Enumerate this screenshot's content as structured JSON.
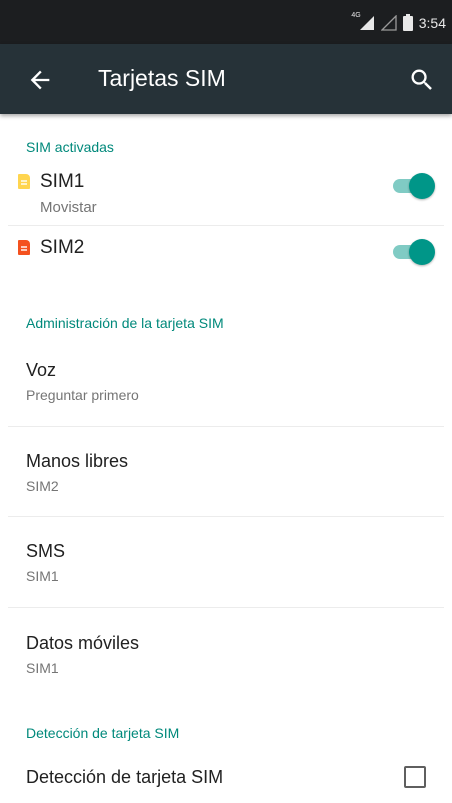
{
  "status_bar": {
    "network": "4G",
    "time": "3:54"
  },
  "app_bar": {
    "title": "Tarjetas SIM"
  },
  "sections": {
    "activated": {
      "header": "SIM activadas",
      "sim1": {
        "name": "SIM1",
        "carrier": "Movistar",
        "enabled": true,
        "color": "#ffd54f"
      },
      "sim2": {
        "name": "SIM2",
        "enabled": true,
        "color": "#f4511e"
      }
    },
    "management": {
      "header": "Administración de la tarjeta SIM",
      "items": [
        {
          "title": "Voz",
          "subtitle": "Preguntar primero"
        },
        {
          "title": "Manos libres",
          "subtitle": "SIM2"
        },
        {
          "title": "SMS",
          "subtitle": "SIM1"
        },
        {
          "title": "Datos móviles",
          "subtitle": "SIM1"
        }
      ]
    },
    "detection": {
      "header": "Detección de tarjeta SIM",
      "item": {
        "title": "Detección de tarjeta SIM",
        "checked": false
      }
    }
  },
  "colors": {
    "accent": "#00897b",
    "toolbar": "#263238",
    "statusbar": "#1c1e20"
  },
  "icons": {
    "back": "arrow-left-icon",
    "search": "search-icon",
    "signal": "signal-icon",
    "battery": "battery-icon",
    "sim1": "sim-card-icon",
    "sim2": "sim-card-icon"
  }
}
